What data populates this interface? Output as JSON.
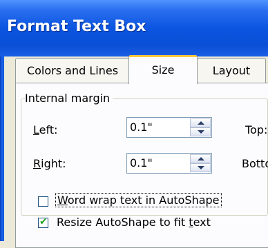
{
  "window": {
    "title": "Format Text Box"
  },
  "tabs": [
    {
      "label": "Colors and Lines",
      "active": false
    },
    {
      "label": "Size",
      "active": true
    },
    {
      "label": "Layout",
      "active": false
    }
  ],
  "internal_margin": {
    "group_label": "Internal margin",
    "left": {
      "label_prefix": "",
      "label_mnemonic": "L",
      "label_rest": "eft:",
      "value": "0.1\""
    },
    "right": {
      "label_prefix": "",
      "label_mnemonic": "R",
      "label_rest": "ight:",
      "value": "0.1\""
    },
    "top": {
      "label": "Top:"
    },
    "bottom": {
      "label": "Botto"
    }
  },
  "options": {
    "word_wrap": {
      "label_mnemonic": "W",
      "label_rest": "ord wrap text in AutoShape",
      "checked": false
    },
    "resize": {
      "label_prefix": "Resize AutoShape to fit ",
      "label_mnemonic": "t",
      "label_rest": "ext",
      "checked": true
    }
  },
  "colors": {
    "titlebar": "#0b55e0",
    "dialog_bg": "#ece9d8",
    "active_tab_highlight": "#ffc83c"
  },
  "icons": [
    "spin-up-arrow-icon",
    "spin-down-arrow-icon",
    "checkmark-icon"
  ]
}
